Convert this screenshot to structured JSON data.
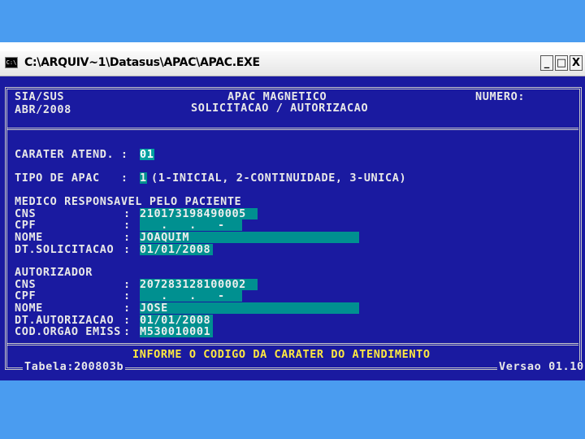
{
  "window": {
    "title": "C:\\ARQUIV~1\\Datasus\\APAC\\APAC.EXE",
    "icon_label": "C:\\",
    "controls": {
      "minimize": "_",
      "maximize": "□",
      "close": "X"
    }
  },
  "header": {
    "system": "SIA/SUS",
    "period": "ABR/2008",
    "app_title": "APAC MAGNETICO",
    "subtitle": "SOLICITACAO / AUTORIZACAO",
    "numero_label": "NUMERO:"
  },
  "form": {
    "carater": {
      "label": "CARATER ATEND. :",
      "value": "01"
    },
    "tipo": {
      "label": "TIPO DE APAC   :",
      "value": "1",
      "hint": "(1-INICIAL, 2-CONTINUIDADE, 3-UNICA)"
    },
    "medico": {
      "heading": "MEDICO RESPONSAVEL PELO PACIENTE",
      "cns_label": "CNS",
      "cns_value": "210173198490005",
      "cpf_label": "CPF",
      "cpf_value": "   .   .   -",
      "nome_label": "NOME",
      "nome_value": "JOAQUIM",
      "dt_label": "DT.SOLICITACAO",
      "dt_value": "01/01/2008"
    },
    "autorizador": {
      "heading": "AUTORIZADOR",
      "cns_label": "CNS",
      "cns_value": "207283128100002",
      "cpf_label": "CPF",
      "cpf_value": "   .   .   -",
      "nome_label": "NOME",
      "nome_value": "JOSE",
      "dt_label": "DT.AUTORIZACAO",
      "dt_value": "01/01/2008",
      "cod_label": "COD.ORGAO EMISS",
      "cod_value": "M530010001"
    },
    "colon": ":"
  },
  "footer": {
    "message": "INFORME O CODIGO DA CARATER DO ATENDIMENTO",
    "tabela": "Tabela:200803b",
    "versao": "Versao 01.10"
  },
  "colors": {
    "background": "#4a9cf0",
    "console_bg": "#1a1aa0",
    "field_bg": "#009090",
    "message": "#ffe840"
  }
}
